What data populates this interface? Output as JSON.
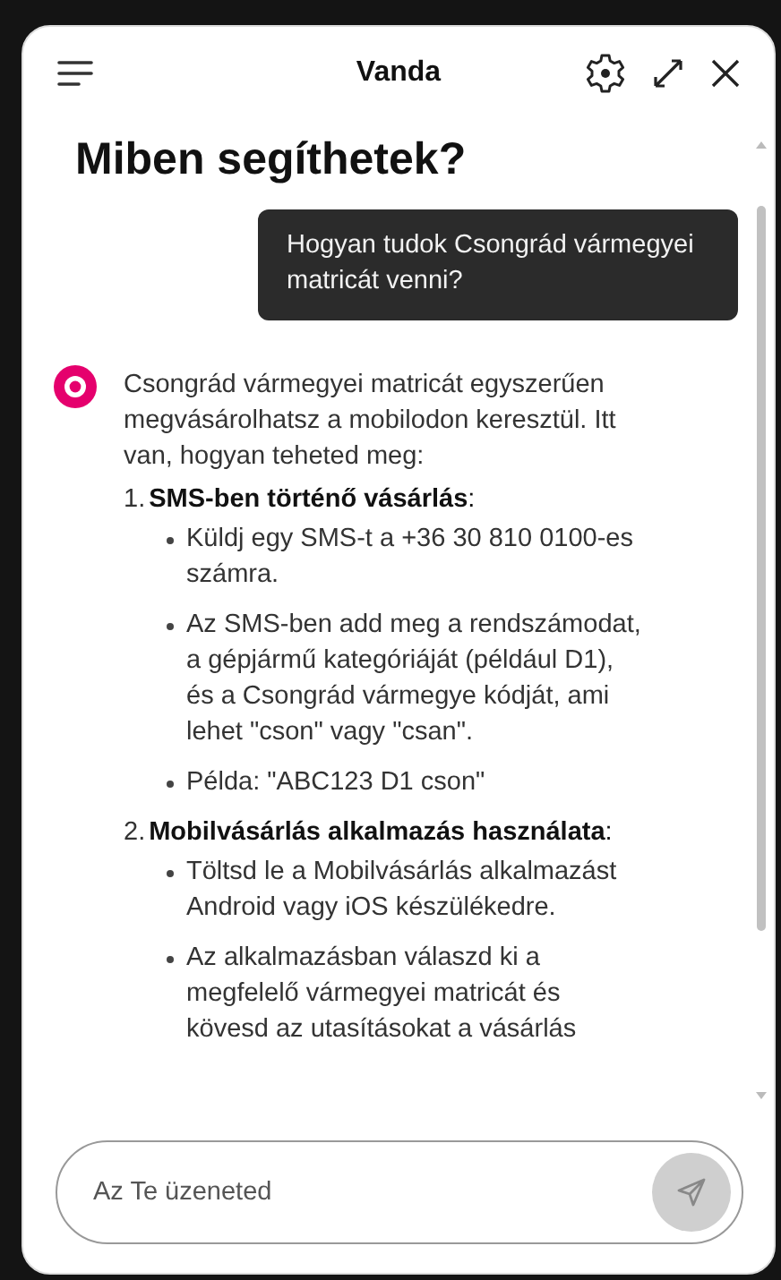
{
  "header": {
    "title": "Vanda"
  },
  "heading": "Miben segíthetek?",
  "messages": [
    {
      "kind": "user",
      "text": "Hogyan tudok Csongrád vármegyei matricát venni?"
    },
    {
      "kind": "assistant",
      "intro": "Csongrád vármegyei matricát egyszerűen megvásárolhatsz a mobilodon keresztül. Itt van, hogyan teheted meg:",
      "steps": [
        {
          "number": "1.",
          "title": "**SMS-ben történő vásárlás**:",
          "bullets": [
            "Küldj egy SMS-t a +36 30 810 0100-es számra.",
            "Az SMS-ben add meg a rendszámodat, a gépjármű kategóriáját (például D1), és a Csongrád vármegye kódját, ami lehet \"cson\" vagy \"csan\".",
            "Példa: \"ABC123 D1 cson\""
          ]
        },
        {
          "number": "2.",
          "title": "**Mobilvásárlás alkalmazás használata**:",
          "bullets": [
            "Töltsd le a Mobilvásárlás alkalmazást Android vagy iOS készülékedre.",
            "Az alkalmazásban válaszd ki a megfelelő vármegyei matricát és kövesd az utasításokat a vásárlás"
          ]
        }
      ]
    }
  ],
  "composer": {
    "placeholder": "Az Te üzeneted"
  }
}
